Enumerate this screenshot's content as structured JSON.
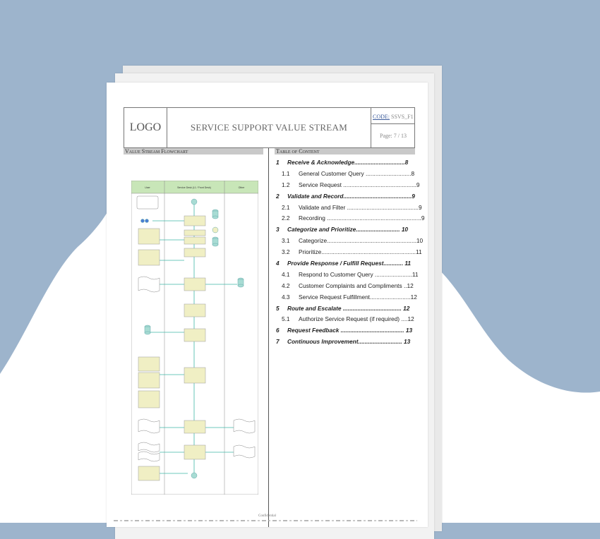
{
  "document": {
    "logo": "LOGO",
    "title": "SERVICE SUPPORT VALUE STREAM",
    "code": "CODE:",
    "code_value": "SSVS_F1",
    "page": "Page: 7 / 13",
    "left_section": "Value Stream Flowchart",
    "right_section": "Table of Content",
    "footer": "Confidential"
  },
  "flowchart": {
    "lanes": [
      "User",
      "Service Desk (L1 / Front Desk)",
      "Other"
    ]
  },
  "toc": [
    {
      "num": "1",
      "text": "Receive & Acknowledge...............................8",
      "level": 1
    },
    {
      "num": "1.1",
      "text": "General Customer Query ............................8",
      "level": 2
    },
    {
      "num": "1.2",
      "text": "Service Request .............................................9",
      "level": 2
    },
    {
      "num": "2",
      "text": "Validate and Record..........................................9",
      "level": 1
    },
    {
      "num": "2.1",
      "text": "Validate and Filter ............................................9",
      "level": 2
    },
    {
      "num": "2.2",
      "text": "Recording ..........................................................9",
      "level": 2
    },
    {
      "num": "3",
      "text": "Categorize and Prioritize........................... 10",
      "level": 1
    },
    {
      "num": "3.1",
      "text": "Categorize.......................................................10",
      "level": 2
    },
    {
      "num": "3.2",
      "text": "Prioritize..........................................................11",
      "level": 2
    },
    {
      "num": "4",
      "text": "Provide Response / Fulfill Request............ 11",
      "level": 1
    },
    {
      "num": "4.1",
      "text": "Respond to Customer Query .......................11",
      "level": 2
    },
    {
      "num": "4.2",
      "text": "Customer Complaints and Compliments ..12",
      "level": 2
    },
    {
      "num": "4.3",
      "text": "Service Request Fulfillment.........................12",
      "level": 2
    },
    {
      "num": "5",
      "text": "Route and Escalate .................................... 12",
      "level": 1
    },
    {
      "num": "5.1",
      "text": "Authorize Service Request (if required) ....12",
      "level": 2
    },
    {
      "num": "6",
      "text": "Request Feedback ....................................... 13",
      "level": 1
    },
    {
      "num": "7",
      "text": "Continuous Improvement........................... 13",
      "level": 1
    }
  ],
  "colors": {
    "background": "#9db4cc",
    "blob": "#ffffff",
    "lane_header": "#c8e6b8",
    "process_box": "#f0efc4",
    "connector": "#3fb8a8",
    "section_bar": "#c9c9c9"
  }
}
